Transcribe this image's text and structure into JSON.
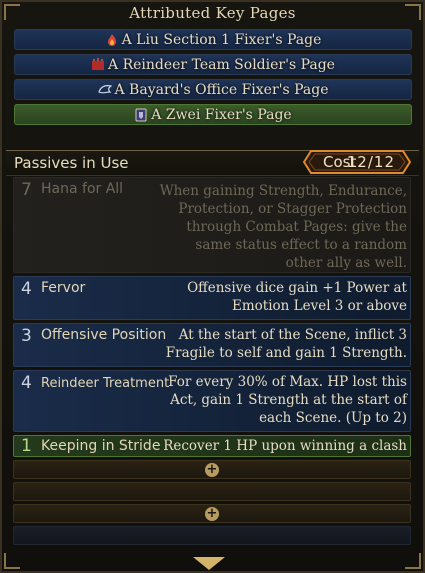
{
  "attributed_title": "Attributed Key Pages",
  "key_pages": [
    {
      "label": "A Liu Section 1 Fixer's Page",
      "icon": "flame-emblem-icon",
      "style": "blue"
    },
    {
      "label": "A Reindeer Team Soldier's Page",
      "icon": "antler-emblem-icon",
      "style": "blue"
    },
    {
      "label": "A Bayard's Office Fixer's Page",
      "icon": "wing-emblem-icon",
      "style": "blue"
    },
    {
      "label": "A Zwei Fixer's Page",
      "icon": "shield-emblem-icon",
      "style": "green"
    }
  ],
  "passives_title": "Passives in Use",
  "cost": {
    "label": "Cost",
    "value": "12/12"
  },
  "passives": [
    {
      "cost": "7",
      "name": "Hana for All",
      "desc": [
        "When gaining Strength, Endurance,",
        "Protection, or Stagger Protection",
        "through Combat Pages: give the",
        "same status effect to a random",
        "other ally as well."
      ],
      "style": "dim"
    },
    {
      "cost": "4",
      "name": "Fervor",
      "desc": [
        "Offensive dice gain +1 Power at",
        "Emotion Level 3 or above"
      ],
      "style": "blue"
    },
    {
      "cost": "3",
      "name": "Offensive Position",
      "desc": [
        "At the start of the Scene, inflict 3",
        "Fragile to self and gain 1 Strength."
      ],
      "style": "blue"
    },
    {
      "cost": "4",
      "name": "Reindeer Treatment",
      "desc": [
        "For every 30% of Max. HP lost this",
        "Act, gain 1 Strength at the start of",
        "each Scene. (Up to 2)"
      ],
      "style": "blue"
    },
    {
      "cost": "1",
      "name": "Keeping in Stride",
      "desc": [
        "Recover 1 HP upon winning a clash"
      ],
      "style": "green"
    }
  ],
  "colors": {
    "accent_orange": "#e08a2c",
    "gold": "#d2b46a",
    "blue_slot": "#1a2c4a",
    "green_slot": "#2a4420"
  }
}
